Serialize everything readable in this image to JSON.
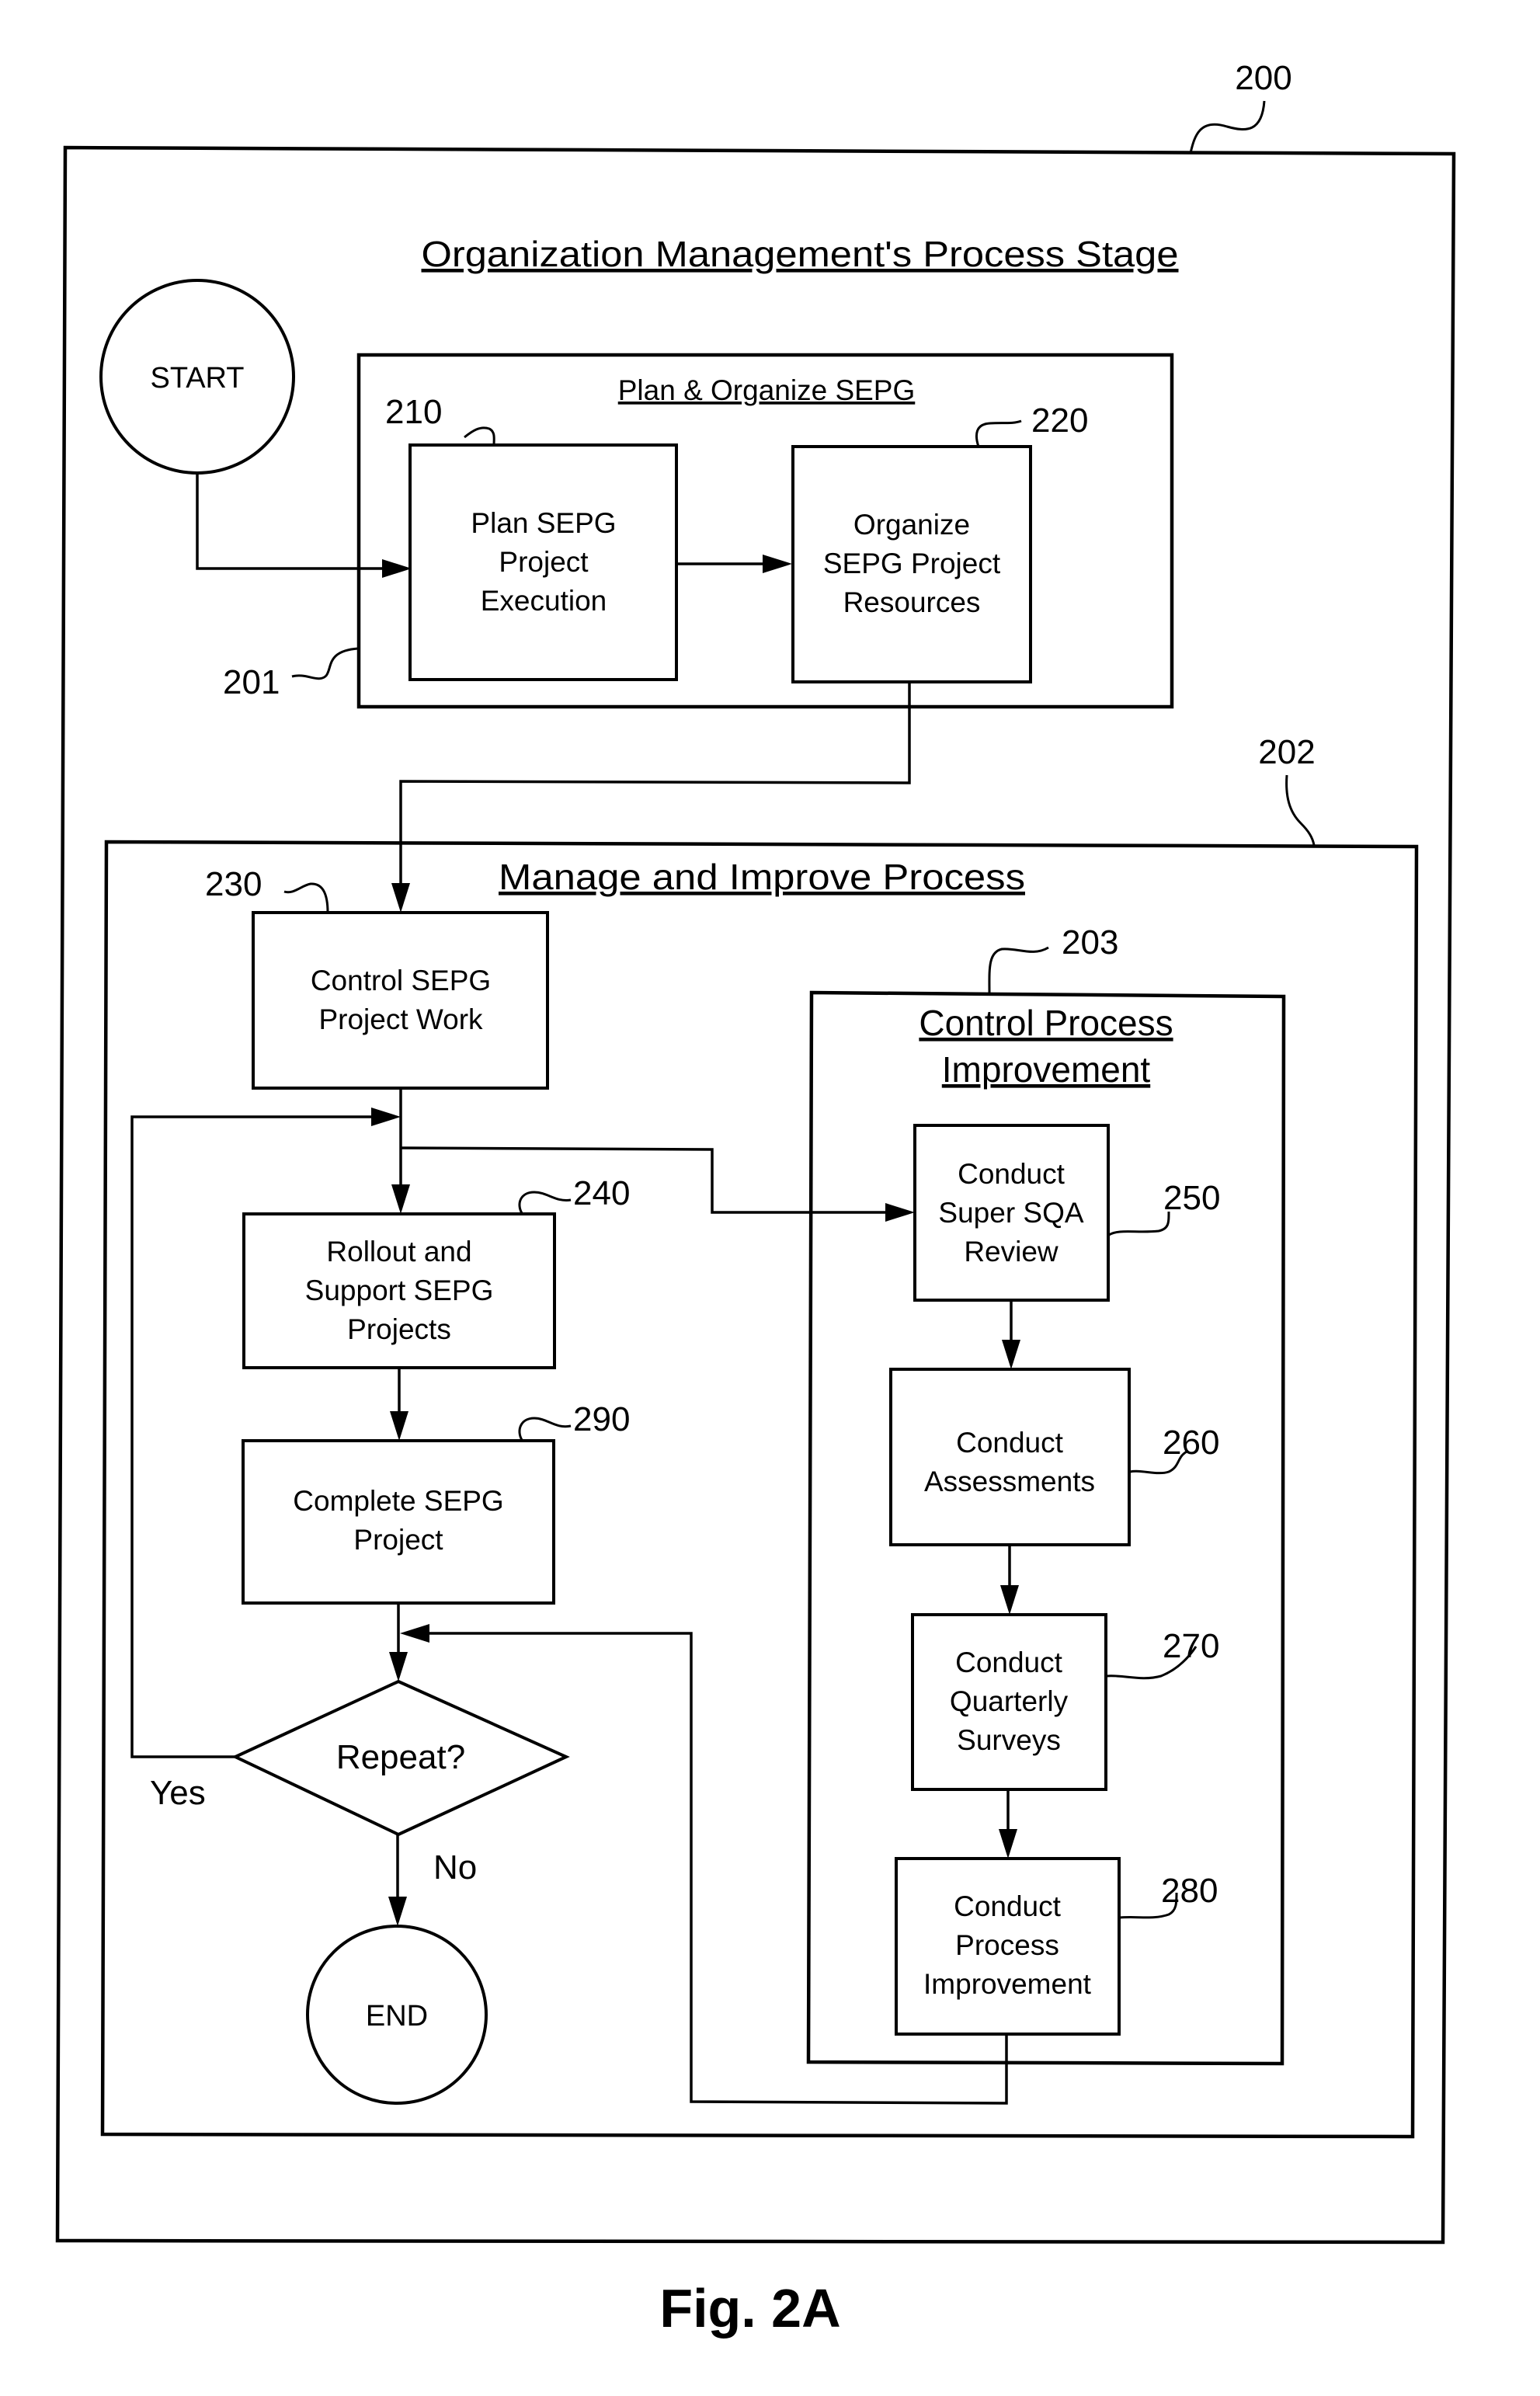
{
  "figure": {
    "label": "Fig. 2A",
    "ref": "200",
    "title": "Organization Management's Process Stage"
  },
  "terminals": {
    "start": "START",
    "end": "END"
  },
  "plan_group": {
    "ref": "201",
    "title": "Plan & Organize SEPG",
    "steps": [
      {
        "ref": "210",
        "lines": [
          "Plan SEPG",
          "Project",
          "Execution"
        ]
      },
      {
        "ref": "220",
        "lines": [
          "Organize",
          "SEPG Project",
          "Resources"
        ]
      }
    ]
  },
  "manage_group": {
    "ref": "202",
    "title": "Manage and Improve Process",
    "steps": [
      {
        "ref": "230",
        "lines": [
          "Control SEPG",
          "Project Work"
        ]
      },
      {
        "ref": "240",
        "lines": [
          "Rollout and",
          "Support SEPG",
          "Projects"
        ]
      },
      {
        "ref": "290",
        "lines": [
          "Complete SEPG",
          "Project"
        ]
      }
    ],
    "decision": {
      "label": "Repeat?",
      "yes": "Yes",
      "no": "No"
    }
  },
  "improvement_group": {
    "ref": "203",
    "title_lines": [
      "Control Process",
      "Improvement"
    ],
    "steps": [
      {
        "ref": "250",
        "lines": [
          "Conduct",
          "Super SQA",
          "Review"
        ]
      },
      {
        "ref": "260",
        "lines": [
          "Conduct",
          "Assessments"
        ]
      },
      {
        "ref": "270",
        "lines": [
          "Conduct",
          "Quarterly",
          "Surveys"
        ]
      },
      {
        "ref": "280",
        "lines": [
          "Conduct",
          "Process",
          "Improvement"
        ]
      }
    ]
  }
}
